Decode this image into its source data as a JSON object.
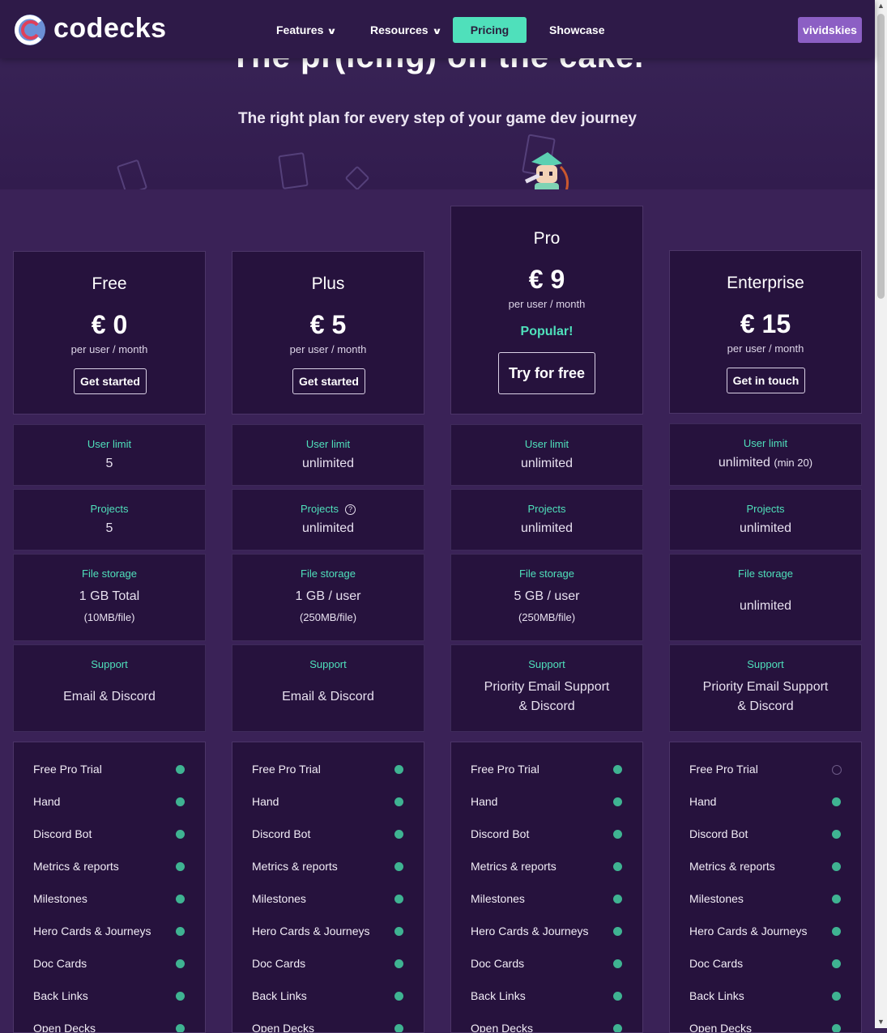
{
  "brand": {
    "name": "codecks"
  },
  "nav": {
    "features": "Features",
    "resources": "Resources",
    "pricing": "Pricing",
    "showcase": "Showcase",
    "user": "vividskies"
  },
  "hero": {
    "title": "The pr(icing) on the cake.",
    "subtitle": "The right plan for every step of your game dev journey"
  },
  "colors": {
    "accent": "#4fe0bb",
    "background": "#3a2257",
    "card": "#26123d",
    "user_button": "#8c5fc4",
    "check": "#3fb392"
  },
  "plans": [
    {
      "name": "Free",
      "price": "€ 0",
      "per": "per user / month",
      "button": "Get started",
      "user_limit": {
        "label": "User limit",
        "value": "5"
      },
      "projects": {
        "label": "Projects",
        "value": "5"
      },
      "storage": {
        "label": "File storage",
        "value": "1 GB Total",
        "sub": "(10MB/file)"
      },
      "support": {
        "label": "Support",
        "line1": "Email & Discord"
      }
    },
    {
      "name": "Plus",
      "price": "€ 5",
      "per": "per user / month",
      "button": "Get started",
      "user_limit": {
        "label": "User limit",
        "value": "unlimited"
      },
      "projects": {
        "label": "Projects",
        "value": "unlimited",
        "help": "?"
      },
      "storage": {
        "label": "File storage",
        "value": "1 GB / user",
        "sub": "(250MB/file)"
      },
      "support": {
        "label": "Support",
        "line1": "Email & Discord"
      }
    },
    {
      "name": "Pro",
      "price": "€ 9",
      "per": "per user / month",
      "popular": "Popular!",
      "button": "Try for free",
      "user_limit": {
        "label": "User limit",
        "value": "unlimited"
      },
      "projects": {
        "label": "Projects",
        "value": "unlimited"
      },
      "storage": {
        "label": "File storage",
        "value": "5 GB / user",
        "sub": "(250MB/file)"
      },
      "support": {
        "label": "Support",
        "line1": "Priority Email Support",
        "line2": "& Discord"
      }
    },
    {
      "name": "Enterprise",
      "price": "€ 15",
      "per": "per user / month",
      "button": "Get in touch",
      "user_limit": {
        "label": "User limit",
        "value": "unlimited",
        "note": "(min 20)"
      },
      "projects": {
        "label": "Projects",
        "value": "unlimited"
      },
      "storage": {
        "label": "File storage",
        "value": "unlimited"
      },
      "support": {
        "label": "Support",
        "line1": "Priority Email Support",
        "line2": "& Discord"
      }
    }
  ],
  "features": [
    "Free Pro Trial",
    "Hand",
    "Discord Bot",
    "Metrics & reports",
    "Milestones",
    "Hero Cards & Journeys",
    "Doc Cards",
    "Back Links",
    "Open Decks"
  ],
  "feature_included": [
    [
      true,
      true,
      true,
      true,
      true,
      true,
      true,
      true,
      true
    ],
    [
      true,
      true,
      true,
      true,
      true,
      true,
      true,
      true,
      true
    ],
    [
      true,
      true,
      true,
      true,
      true,
      true,
      true,
      true,
      true
    ],
    [
      false,
      true,
      true,
      true,
      true,
      true,
      true,
      true,
      true
    ]
  ]
}
